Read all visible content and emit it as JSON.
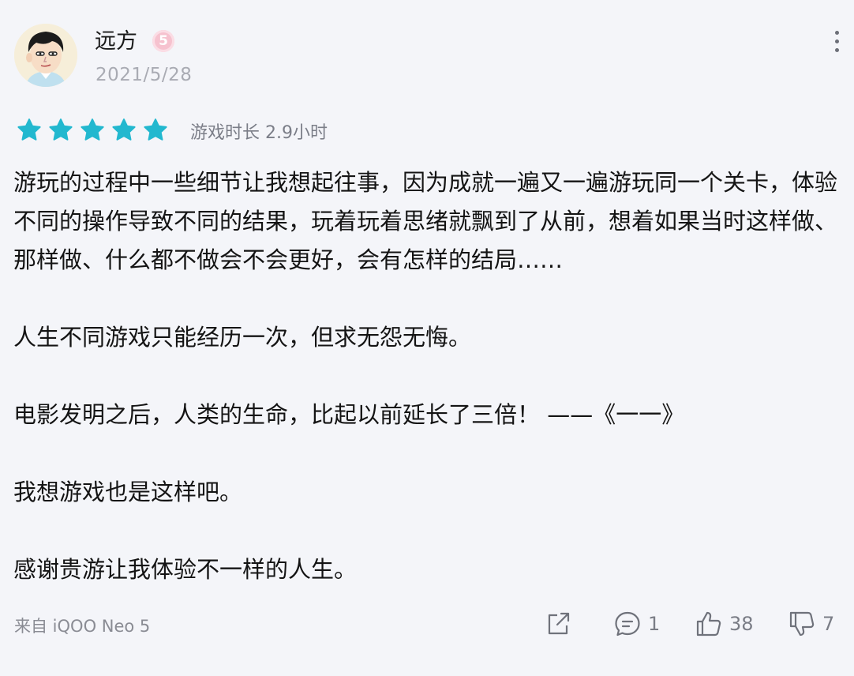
{
  "header": {
    "username": "远方",
    "level": "5",
    "date": "2021/5/28"
  },
  "rating": {
    "stars": 5,
    "max_stars": 5,
    "star_color": "#22b8cf",
    "playtime": "游戏时长 2.9小时"
  },
  "review": {
    "paragraphs": [
      "游玩的过程中一些细节让我想起往事，因为成就一遍又一遍游玩同一个关卡，体验不同的操作导致不同的结果，玩着玩着思绪就飘到了从前，想着如果当时这样做、那样做、什么都不做会不会更好，会有怎样的结局……",
      "人生不同游戏只能经历一次，但求无怨无悔。",
      "电影发明之后，人类的生命，比起以前延长了三倍！ ——《一一》",
      "我想游戏也是这样吧。",
      "感谢贵游让我体验不一样的人生。"
    ]
  },
  "footer": {
    "device": "来自 iQOO Neo 5",
    "share_icon": "share-icon",
    "comment_count": "1",
    "like_count": "38",
    "dislike_count": "7"
  }
}
